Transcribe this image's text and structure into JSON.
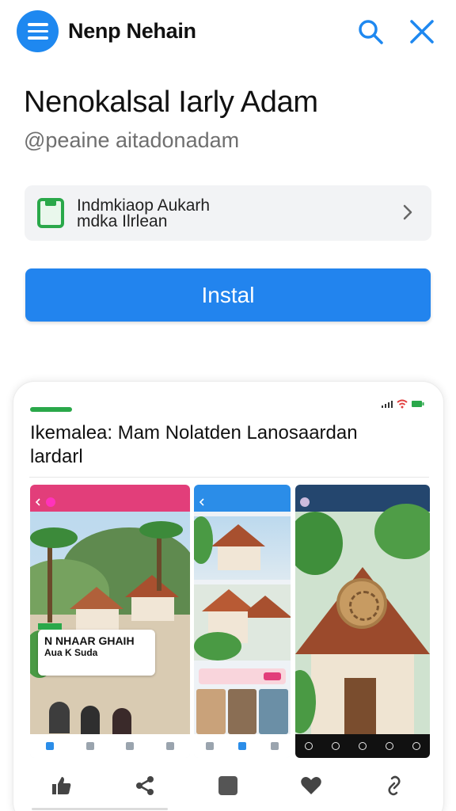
{
  "header": {
    "app_name": "Nenp Nehain",
    "menu_icon": "hamburger-menu-icon",
    "search_icon": "search-icon",
    "close_icon": "close-icon",
    "accent_color": "#1e88f0"
  },
  "title": "Nenokalsal Iarly Adam",
  "handle": "@peaine aitadonadam",
  "info_row": {
    "icon": "bag-icon",
    "line1": "Indmkiaop Aukarh",
    "line2": "mdka Ilrlean",
    "chevron_icon": "chevron-right-icon"
  },
  "install_label": "Instal",
  "card": {
    "title": "Ikemalea: Mam Nolatden Lanosaardan lardarl",
    "accent_color": "#2aa84a",
    "promo": {
      "line1": "N NHAAR GHAIH",
      "line2": "Aua K Suda"
    }
  },
  "bottom_bar": [
    {
      "name": "like-icon"
    },
    {
      "name": "share-icon"
    },
    {
      "name": "square-icon"
    },
    {
      "name": "heart-icon"
    },
    {
      "name": "link-icon"
    }
  ]
}
